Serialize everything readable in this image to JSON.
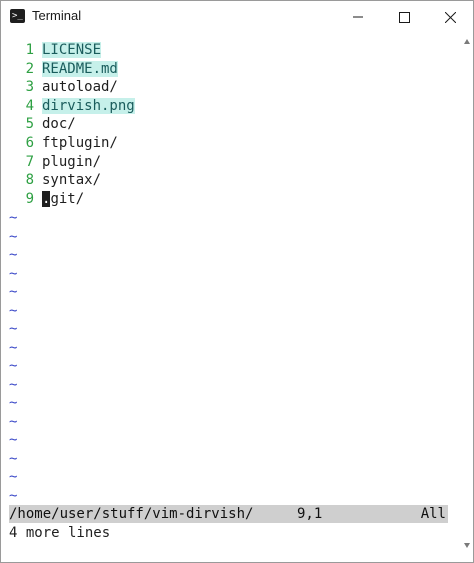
{
  "window": {
    "title": "Terminal",
    "icon": "terminal-icon",
    "controls": [
      "minimize-icon",
      "maximize-icon",
      "close-icon"
    ]
  },
  "buffer": {
    "lines": [
      {
        "num": "1",
        "text": "LICENSE",
        "highlight": true
      },
      {
        "num": "2",
        "text": "README.md",
        "highlight": true
      },
      {
        "num": "3",
        "text": "autoload/",
        "highlight": false
      },
      {
        "num": "4",
        "text": "dirvish.png",
        "highlight": true
      },
      {
        "num": "5",
        "text": "doc/",
        "highlight": false
      },
      {
        "num": "6",
        "text": "ftplugin/",
        "highlight": false
      },
      {
        "num": "7",
        "text": "plugin/",
        "highlight": false
      },
      {
        "num": "8",
        "text": "syntax/",
        "highlight": false
      },
      {
        "num": "9",
        "text_cursor": ".",
        "text_rest": "git/",
        "highlight": false
      }
    ],
    "tilde": "~",
    "tilde_count": 16
  },
  "statusline": {
    "path": "/home/user/stuff/vim-dirvish/",
    "position": "9,1",
    "scroll": "All"
  },
  "cmdline": {
    "message": "4 more lines"
  },
  "colors": {
    "line_number": "#2ea043",
    "file_highlight_bg": "#c6f0ea",
    "tilde": "#3b49c8",
    "statusline_bg": "#cfcfcf"
  }
}
